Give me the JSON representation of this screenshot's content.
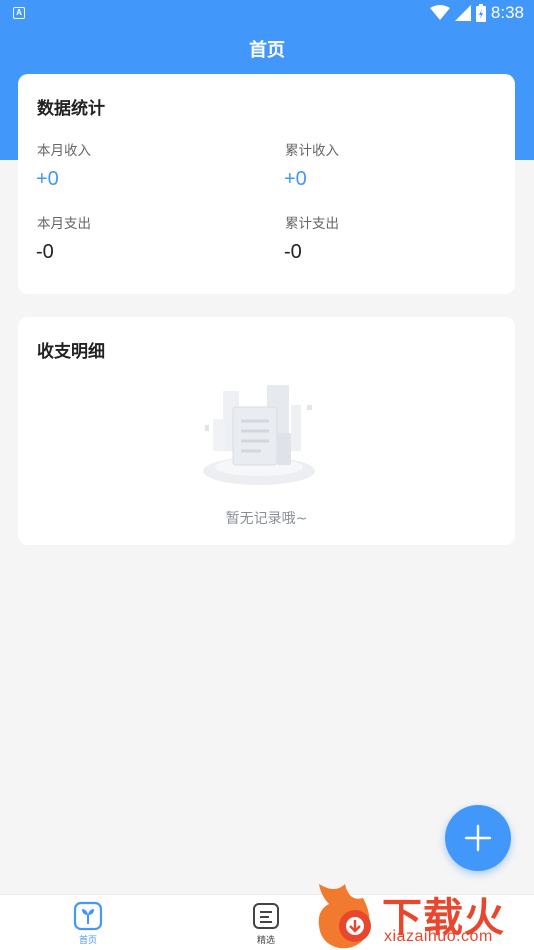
{
  "status_bar": {
    "left_indicator": "A",
    "time": "8:38"
  },
  "header": {
    "title": "首页",
    "accent_color": "#4297fb"
  },
  "stats_card": {
    "title": "数据统计",
    "items": [
      {
        "label": "本月收入",
        "value": "+0"
      },
      {
        "label": "累计收入",
        "value": "+0"
      },
      {
        "label": "本月支出",
        "value": "-0"
      },
      {
        "label": "累计支出",
        "value": "-0"
      }
    ]
  },
  "details_card": {
    "title": "收支明细",
    "empty_text": "暂无记录哦~"
  },
  "fab": {
    "icon": "plus-icon"
  },
  "tabbar": {
    "tabs": [
      {
        "label": "首页",
        "icon": "home-plant-icon",
        "active": true
      },
      {
        "label": "精选",
        "icon": "list-icon",
        "active": false
      }
    ],
    "active_color": "#4297fb",
    "inactive_color": "#444444"
  },
  "watermark": {
    "title": "下载火",
    "subtitle": "xiazaihuo.com"
  }
}
